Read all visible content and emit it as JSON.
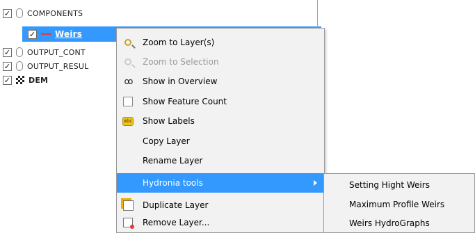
{
  "layers": [
    {
      "name": "COMPONENTS",
      "checked": true,
      "icon": "group-clip-icon",
      "selected": false,
      "bold": false
    },
    {
      "name": "Weirs",
      "checked": true,
      "icon": "line-layer-icon",
      "selected": true,
      "bold": true
    },
    {
      "name": "OUTPUT_CONT",
      "checked": true,
      "icon": "group-clip-icon",
      "selected": false,
      "bold": false
    },
    {
      "name": "OUTPUT_RESUL",
      "checked": true,
      "icon": "group-clip-icon",
      "selected": false,
      "bold": false
    },
    {
      "name": "DEM",
      "checked": true,
      "icon": "raster-layer-icon",
      "selected": false,
      "bold": true
    }
  ],
  "check_glyph": "✓",
  "context_menu": {
    "items": [
      {
        "label": "Zoom to Layer(s)",
        "icon": "zoom-layer-icon",
        "enabled": true
      },
      {
        "label": "Zoom to Selection",
        "icon": "zoom-selection-icon",
        "enabled": false
      },
      {
        "label": "Show in Overview",
        "icon": "overview-glasses-icon",
        "enabled": true
      },
      {
        "label": "Show Feature Count",
        "icon": "feature-count-checkbox-icon",
        "enabled": true
      },
      {
        "label": "Show Labels",
        "icon": "labels-icon",
        "enabled": true
      },
      {
        "label": "Copy Layer",
        "icon": "",
        "enabled": true
      },
      {
        "label": "Rename Layer",
        "icon": "",
        "enabled": true
      },
      {
        "label": "Hydronia tools",
        "icon": "",
        "enabled": true,
        "highlighted": true,
        "has_submenu": true
      },
      {
        "label": "Duplicate Layer",
        "icon": "duplicate-layer-icon",
        "enabled": true
      },
      {
        "label": "Remove Layer...",
        "icon": "remove-layer-icon",
        "enabled": true
      }
    ]
  },
  "submenu": {
    "items": [
      {
        "label": "Setting Hight Weirs"
      },
      {
        "label": "Maximum Profile Weirs"
      },
      {
        "label": "Weirs HydroGraphs"
      }
    ]
  },
  "colors": {
    "selection": "#3399ff",
    "menu_bg": "#f2f2f2",
    "disabled": "#9a9a9a"
  }
}
